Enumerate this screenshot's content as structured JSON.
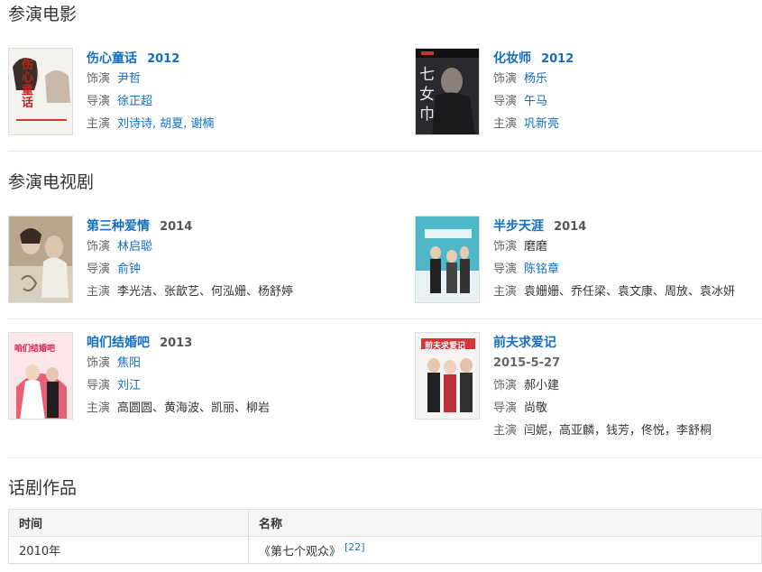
{
  "sections": {
    "films_title": "参演电影",
    "tv_title": "参演电视剧",
    "plays_title": "话剧作品"
  },
  "labels": {
    "role": "饰演",
    "director": "导演",
    "cast": "主演"
  },
  "films": [
    {
      "title": "伤心童话",
      "year": "2012",
      "role": "尹哲",
      "director": "徐正超",
      "cast": "刘诗诗, 胡夏, 谢楠"
    },
    {
      "title": "化妆师",
      "year": "2012",
      "role": "杨乐",
      "director": "午马",
      "cast": "巩新亮"
    }
  ],
  "tv": [
    {
      "title": "第三种爱情",
      "year": "2014",
      "role": "林启聪",
      "director": "俞钟",
      "cast": "李光洁、张歆艺、何泓姗、杨舒婷"
    },
    {
      "title": "半步天涯",
      "year": "2014",
      "role": "磨磨",
      "director": "陈铭章",
      "cast": "袁姗姗、乔任梁、袁文康、周放、袁冰妍"
    },
    {
      "title": "咱们结婚吧",
      "year": "2013",
      "role": "焦阳",
      "director": "刘江",
      "cast": "高圆圆、黄海波、凯丽、柳岩"
    },
    {
      "title": "前夫求爱记",
      "date": "2015-5-27",
      "role": "郝小建",
      "director": "尚敬",
      "cast": "闫妮，高亚麟，钱芳，佟悦，李舒桐"
    }
  ],
  "posters": {
    "film1_text": "伤心童话",
    "film2_text": "七女巾",
    "tv3_text": "咱们结婚吧",
    "tv4_text": "前夫求爱记"
  },
  "plays": {
    "headers": [
      "时间",
      "名称"
    ],
    "rows": [
      {
        "time": "2010年",
        "name": "《第七个观众》",
        "ref": "[22]"
      }
    ]
  },
  "colors": {
    "link": "#136ec2",
    "text": "#333333",
    "label": "#666666",
    "divider": "#e6e6e6"
  }
}
